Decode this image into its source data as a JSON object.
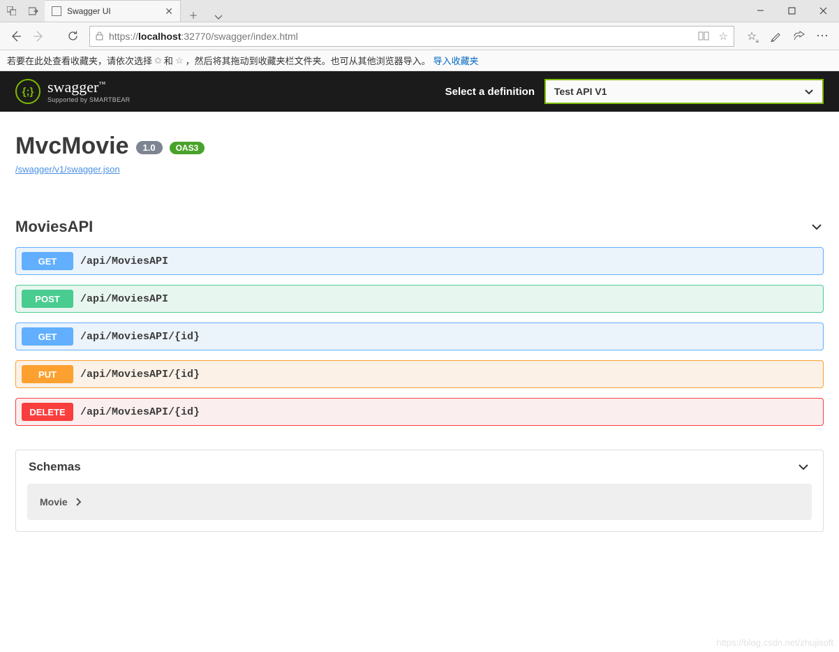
{
  "browser": {
    "tab_title": "Swagger UI",
    "url_prefix": "https://",
    "url_host": "localhost",
    "url_port": ":32770",
    "url_path": "/swagger/index.html",
    "bookmarks_msg_1": "若要在此处查看收藏夹，请依次选择",
    "bookmarks_msg_2": "和",
    "bookmarks_msg_3": "，然后将其拖动到收藏夹栏文件夹。也可从其他浏览器导入。",
    "bookmarks_link": "导入收藏夹"
  },
  "header": {
    "brand": "swagger",
    "supported_by": "Supported by SMARTBEAR",
    "select_label": "Select a definition",
    "definition_value": "Test API V1"
  },
  "api": {
    "title": "MvcMovie",
    "version": "1.0",
    "oas": "OAS3",
    "spec_link": "/swagger/v1/swagger.json"
  },
  "tag": {
    "name": "MoviesAPI",
    "ops": [
      {
        "method": "GET",
        "cls": "get",
        "path": "/api/MoviesAPI"
      },
      {
        "method": "POST",
        "cls": "post",
        "path": "/api/MoviesAPI"
      },
      {
        "method": "GET",
        "cls": "get",
        "path": "/api/MoviesAPI/{id}"
      },
      {
        "method": "PUT",
        "cls": "put",
        "path": "/api/MoviesAPI/{id}"
      },
      {
        "method": "DELETE",
        "cls": "delete",
        "path": "/api/MoviesAPI/{id}"
      }
    ]
  },
  "schemas": {
    "title": "Schemas",
    "items": [
      "Movie"
    ]
  },
  "watermark": "https://blog.csdn.net/zhujisoft"
}
